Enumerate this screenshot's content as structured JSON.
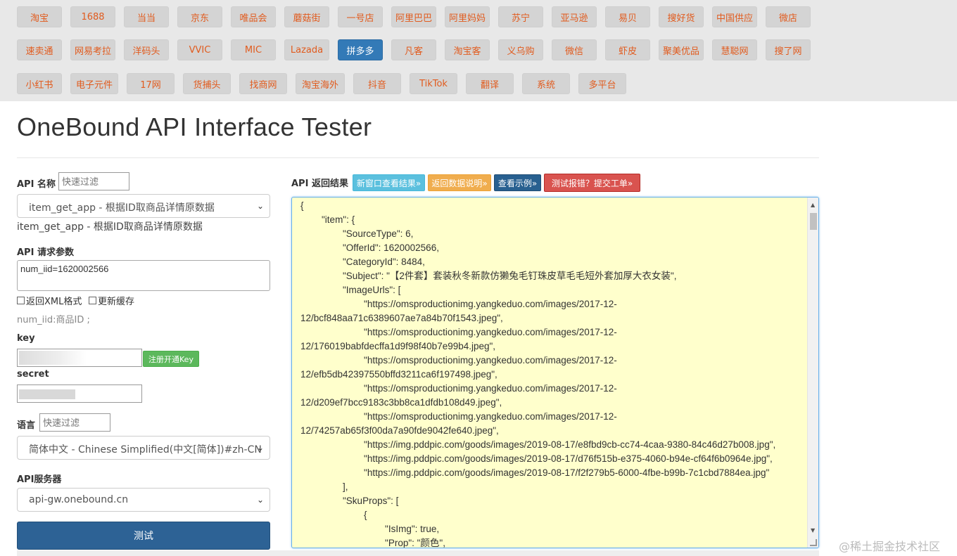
{
  "nav": {
    "row1": [
      "淘宝",
      "1688",
      "当当",
      "京东",
      "唯品会",
      "蘑菇街",
      "一号店",
      "阿里巴巴",
      "阿里妈妈",
      "苏宁",
      "亚马逊",
      "易贝",
      "搜好货",
      "中国供应",
      "微店"
    ],
    "row2": [
      "速卖通",
      "网易考拉",
      "洋码头",
      "VVIC",
      "MIC",
      "Lazada",
      "拼多多",
      "凡客",
      "淘宝客",
      "义乌购",
      "微信",
      "虾皮",
      "聚美优品",
      "慧聪网",
      "搜了网"
    ],
    "row3": [
      "小红书",
      "电子元件",
      "17网",
      "货捕头",
      "找商网",
      "淘宝海外",
      "抖音",
      "TikTok",
      "翻译",
      "系统",
      "多平台"
    ],
    "active": "拼多多"
  },
  "page_title": "OneBound API Interface Tester",
  "form": {
    "api_name_label": "API 名称",
    "filter_placeholder": "快速过滤",
    "api_select_value": "item_get_app - 根据ID取商品详情原数据",
    "api_desc": "item_get_app - 根据ID取商品详情原数据",
    "params_label": "API 请求参数",
    "params_value": "num_iid=1620002566",
    "chk_xml": "返回XML格式",
    "chk_cache": "更新缓存",
    "param_hint": "num_iid:商品ID ;",
    "key_label": "key",
    "register_btn": "注册开通Key",
    "secret_label": "secret",
    "lang_label": "语言",
    "lang_filter_placeholder": "快速过滤",
    "lang_value": "简体中文 - Chinese Simplified(中文[简体])#zh-CN",
    "server_label": "API服务器",
    "server_value": "api-gw.onebound.cn",
    "test_btn": "测试"
  },
  "result": {
    "label": "API 返回结果",
    "btn_new_window": "新窗口查看结果»",
    "btn_doc": "返回数据说明»",
    "btn_example": "查看示例»",
    "btn_report": "测试报错？提交工单»",
    "json_text": "{\n        \"item\": {\n                \"SourceType\": 6,\n                \"OfferId\": 1620002566,\n                \"CategoryId\": 8484,\n                \"Subject\": \"【2件套】套装秋冬新款仿獭兔毛钉珠皮草毛毛短外套加厚大衣女装\",\n                \"ImageUrls\": [\n                        \"https://omsproductionimg.yangkeduo.com/images/2017-12-\n12/bcf848aa71c6389607ae7a84b70f1543.jpeg\",\n                        \"https://omsproductionimg.yangkeduo.com/images/2017-12-\n12/176019babfdecffa1d9f98f40b7e99b4.jpeg\",\n                        \"https://omsproductionimg.yangkeduo.com/images/2017-12-\n12/efb5db42397550bffd3211ca6f197498.jpeg\",\n                        \"https://omsproductionimg.yangkeduo.com/images/2017-12-\n12/d209ef7bcc9183c3bb8ca1dfdb108d49.jpeg\",\n                        \"https://omsproductionimg.yangkeduo.com/images/2017-12-\n12/74257ab65f3f00da7a90fde9042fe640.jpeg\",\n                        \"https://img.pddpic.com/goods/images/2019-08-17/e8fbd9cb-cc74-4caa-9380-84c46d27b008.jpg\",\n                        \"https://img.pddpic.com/goods/images/2019-08-17/d76f515b-e375-4060-b94e-cf64f6b0964e.jpg\",\n                        \"https://img.pddpic.com/goods/images/2019-08-17/f2f279b5-6000-4fbe-b99b-7c1cbd7884ea.jpg\"\n                ],\n                \"SkuProps\": [\n                        {\n                                \"IsImg\": true,\n                                \"Prop\": \"颜色\","
  },
  "colors": {
    "nav_bg": "#e8e8e8",
    "nav_text": "#e15b1e",
    "active_bg": "#337ab7",
    "btn_info": "#5bc0de",
    "btn_warning": "#f0ad4e",
    "btn_primary": "#286090",
    "btn_danger": "#d9534f",
    "result_bg": "#ffffcc"
  },
  "watermark": "@稀土掘金技术社区"
}
